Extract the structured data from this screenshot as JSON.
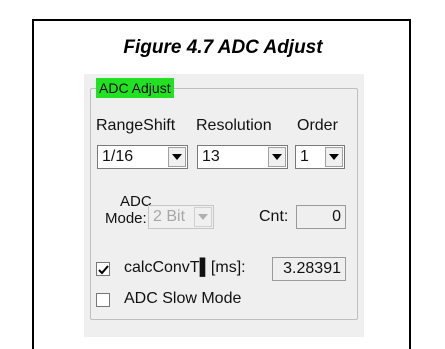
{
  "caption": "Figure 4.7   ADC Adjust",
  "group": {
    "title": "ADC Adjust",
    "title_bg": "#22e022"
  },
  "columns": {
    "range_shift_label": "RangeShift",
    "resolution_label": "Resolution",
    "order_label": "Order"
  },
  "range_shift": {
    "value": "1/16"
  },
  "resolution": {
    "value": "13"
  },
  "order": {
    "value": "1"
  },
  "adc_mode": {
    "label_line1": "ADC",
    "label_line2": "Mode:",
    "value": "2 Bit",
    "enabled": false
  },
  "cnt": {
    "label": "Cnt:",
    "value": "0"
  },
  "calc_conv": {
    "label": "calcConvT▌[ms]:",
    "checked": true,
    "value": "3.28391"
  },
  "slow_mode": {
    "label": "ADC Slow Mode",
    "checked": false
  }
}
